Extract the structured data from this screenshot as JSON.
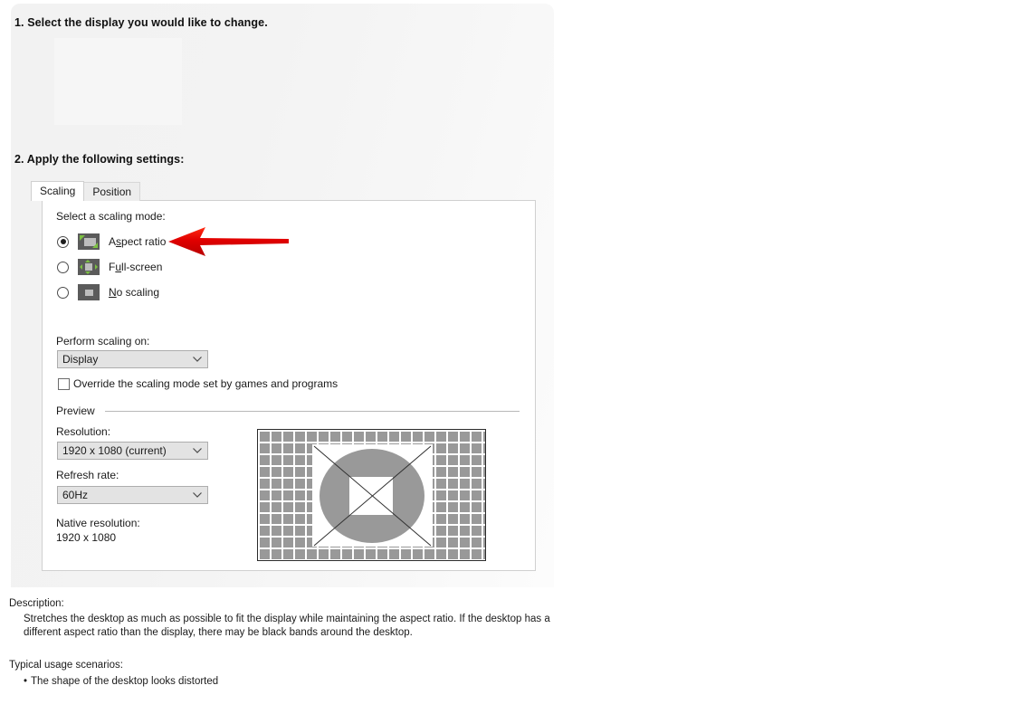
{
  "panel": {
    "step1_heading": "1. Select the display you would like to change.",
    "step2_heading": "2. Apply the following settings:"
  },
  "tabs": [
    {
      "label": "Scaling",
      "active": true
    },
    {
      "label": "Position",
      "active": false
    }
  ],
  "scaling_tab": {
    "section_label": "Select a scaling mode:",
    "modes": [
      {
        "label_pre": "A",
        "label_accel": "s",
        "label_post": "pect ratio",
        "full": "Aspect ratio",
        "selected": true,
        "icon": "aspect-ratio-icon"
      },
      {
        "label_pre": "F",
        "label_accel": "u",
        "label_post": "ll-screen",
        "full": "Full-screen",
        "selected": false,
        "icon": "full-screen-icon"
      },
      {
        "label_pre": "",
        "label_accel": "N",
        "label_post": "o scaling",
        "full": "No scaling",
        "selected": false,
        "icon": "no-scaling-icon"
      }
    ],
    "perform_scaling_label": "Perform scaling on:",
    "perform_scaling_value": "Display",
    "override_checkbox_label": "Override the scaling mode set by games and programs",
    "override_checked": false,
    "preview_group_label": "Preview",
    "resolution_label": "Resolution:",
    "resolution_value": "1920 x 1080 (current)",
    "refresh_label": "Refresh rate:",
    "refresh_value": "60Hz",
    "native_label": "Native resolution:",
    "native_value": "1920 x 1080"
  },
  "description": {
    "title": "Description:",
    "body": "Stretches the desktop as much as possible to fit the display while maintaining the aspect ratio. If the desktop has a different aspect ratio than the display, there may be black bands around the desktop.",
    "scenarios_title": "Typical usage scenarios:",
    "scenarios": [
      {
        "bullet": "•",
        "text": "The shape of the desktop looks distorted"
      }
    ]
  },
  "annotation": {
    "arrow_name": "red-pointer-arrow",
    "arrow_color": "#e00000",
    "points_to": "Aspect ratio"
  },
  "colors": {
    "panel_bg": "#f2f2f2",
    "tab_active_bg": "#ffffff",
    "tab_inactive_bg": "#ededed",
    "combo_bg": "#e3e3e3",
    "icon_dark": "#5b5b5b",
    "icon_screen": "#bdbdbd",
    "icon_accent_green": "#7cc142",
    "pattern_gray": "#999999"
  }
}
